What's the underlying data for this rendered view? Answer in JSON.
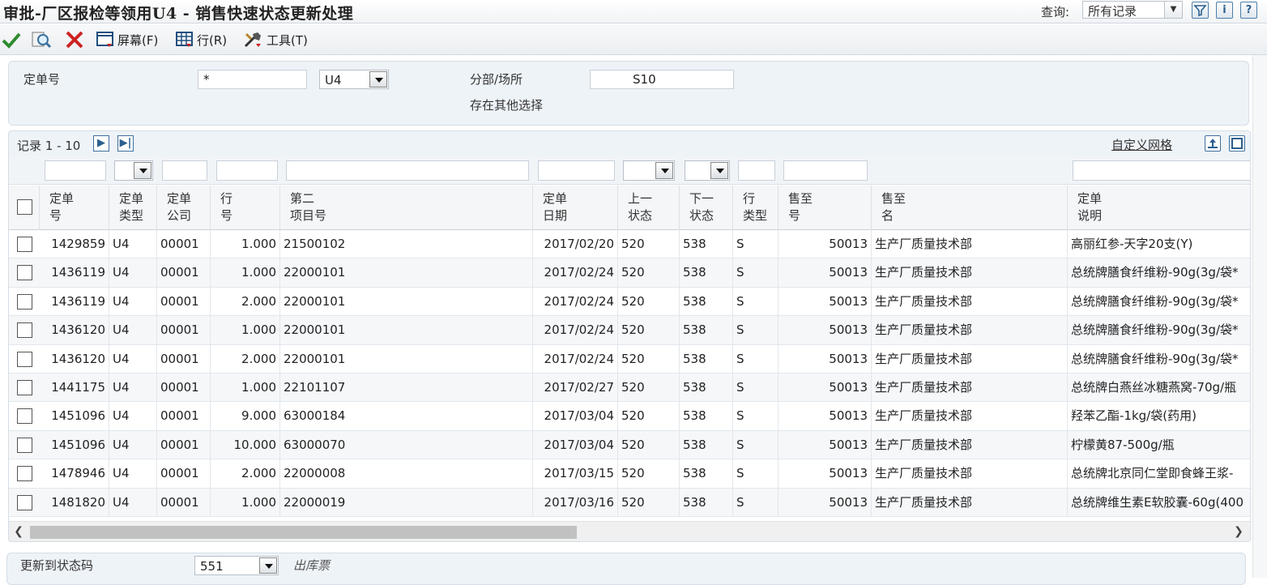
{
  "window": {
    "title": "审批-厂区报检等领用U4 - 销售快速状态更新处理",
    "query_label": "查询:",
    "query_value": "所有记录"
  },
  "toolbar": {
    "screen_label": "屏幕(F)",
    "row_label": "行(R)",
    "tools_label": "工具(T)"
  },
  "filter": {
    "order_no_label": "定单号",
    "order_no_value": "*",
    "order_type_value": "U4",
    "branch_label": "分部/场所",
    "branch_value": "S10",
    "other_selection_label": "存在其他选择"
  },
  "grid": {
    "record_label": "记录 1 - 10",
    "next_icon": "▶",
    "last_icon": "▶|",
    "custom_grid_label": "自定义网格",
    "columns": [
      {
        "l1": "定单",
        "l2": "号"
      },
      {
        "l1": "定单",
        "l2": "类型"
      },
      {
        "l1": "定单",
        "l2": "公司"
      },
      {
        "l1": "行",
        "l2": "号"
      },
      {
        "l1": "第二",
        "l2": "项目号"
      },
      {
        "l1": "定单",
        "l2": "日期"
      },
      {
        "l1": "上一",
        "l2": "状态"
      },
      {
        "l1": "下一",
        "l2": "状态"
      },
      {
        "l1": "行",
        "l2": "类型"
      },
      {
        "l1": "售至",
        "l2": "号"
      },
      {
        "l1": "售至",
        "l2": "名"
      },
      {
        "l1": "定单",
        "l2": "说明"
      }
    ],
    "rows": [
      {
        "order_no": "1429859",
        "type": "U4",
        "company": "00001",
        "line": "1.000",
        "item": "21500102",
        "date": "2017/02/20",
        "prev": "520",
        "next": "538",
        "line_type": "S",
        "sold_to": "50013",
        "sold_name": "生产厂质量技术部",
        "desc": "高丽红参-天字20支(Y)"
      },
      {
        "order_no": "1436119",
        "type": "U4",
        "company": "00001",
        "line": "1.000",
        "item": "22000101",
        "date": "2017/02/24",
        "prev": "520",
        "next": "538",
        "line_type": "S",
        "sold_to": "50013",
        "sold_name": "生产厂质量技术部",
        "desc": "总统牌膳食纤维粉-90g(3g/袋*"
      },
      {
        "order_no": "1436119",
        "type": "U4",
        "company": "00001",
        "line": "2.000",
        "item": "22000101",
        "date": "2017/02/24",
        "prev": "520",
        "next": "538",
        "line_type": "S",
        "sold_to": "50013",
        "sold_name": "生产厂质量技术部",
        "desc": "总统牌膳食纤维粉-90g(3g/袋*"
      },
      {
        "order_no": "1436120",
        "type": "U4",
        "company": "00001",
        "line": "1.000",
        "item": "22000101",
        "date": "2017/02/24",
        "prev": "520",
        "next": "538",
        "line_type": "S",
        "sold_to": "50013",
        "sold_name": "生产厂质量技术部",
        "desc": "总统牌膳食纤维粉-90g(3g/袋*"
      },
      {
        "order_no": "1436120",
        "type": "U4",
        "company": "00001",
        "line": "2.000",
        "item": "22000101",
        "date": "2017/02/24",
        "prev": "520",
        "next": "538",
        "line_type": "S",
        "sold_to": "50013",
        "sold_name": "生产厂质量技术部",
        "desc": "总统牌膳食纤维粉-90g(3g/袋*"
      },
      {
        "order_no": "1441175",
        "type": "U4",
        "company": "00001",
        "line": "1.000",
        "item": "22101107",
        "date": "2017/02/27",
        "prev": "520",
        "next": "538",
        "line_type": "S",
        "sold_to": "50013",
        "sold_name": "生产厂质量技术部",
        "desc": "总统牌白燕丝冰糖燕窝-70g/瓶"
      },
      {
        "order_no": "1451096",
        "type": "U4",
        "company": "00001",
        "line": "9.000",
        "item": "63000184",
        "date": "2017/03/04",
        "prev": "520",
        "next": "538",
        "line_type": "S",
        "sold_to": "50013",
        "sold_name": "生产厂质量技术部",
        "desc": "羟苯乙酯-1kg/袋(药用)"
      },
      {
        "order_no": "1451096",
        "type": "U4",
        "company": "00001",
        "line": "10.000",
        "item": "63000070",
        "date": "2017/03/04",
        "prev": "520",
        "next": "538",
        "line_type": "S",
        "sold_to": "50013",
        "sold_name": "生产厂质量技术部",
        "desc": "柠檬黄87-500g/瓶"
      },
      {
        "order_no": "1478946",
        "type": "U4",
        "company": "00001",
        "line": "2.000",
        "item": "22000008",
        "date": "2017/03/15",
        "prev": "520",
        "next": "538",
        "line_type": "S",
        "sold_to": "50013",
        "sold_name": "生产厂质量技术部",
        "desc": "总统牌北京同仁堂即食蜂王浆-"
      },
      {
        "order_no": "1481820",
        "type": "U4",
        "company": "00001",
        "line": "1.000",
        "item": "22000019",
        "date": "2017/03/16",
        "prev": "520",
        "next": "538",
        "line_type": "S",
        "sold_to": "50013",
        "sold_name": "生产厂质量技术部",
        "desc": "总统牌维生素E软胶囊-60g(400"
      }
    ]
  },
  "bottom": {
    "update_status_label": "更新到状态码",
    "status_value": "551",
    "status_desc": "出库票"
  },
  "colors": {
    "accent": "#2b5f8f",
    "panel_bg": "#eef3f8",
    "ok_green": "#2e8b2e",
    "cancel_red": "#cc2222"
  }
}
